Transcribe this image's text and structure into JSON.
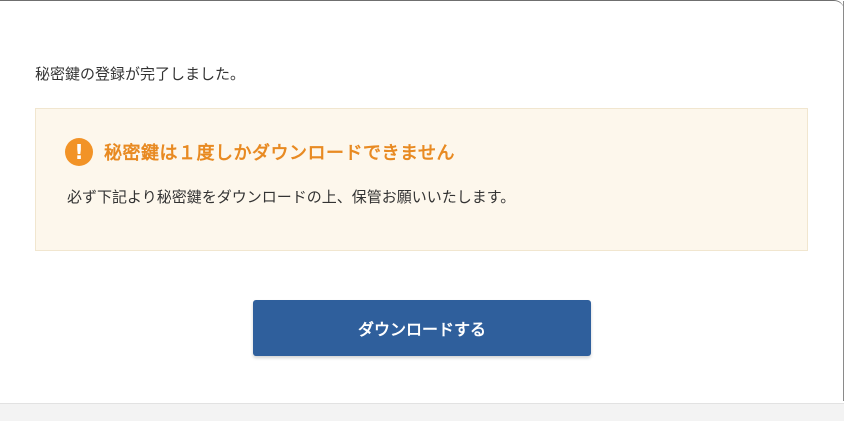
{
  "dialog": {
    "message": "秘密鍵の登録が完了しました。",
    "notice": {
      "icon": "exclamation-circle-icon",
      "icon_glyph": "!",
      "title": "秘密鍵は１度しかダウンロードできません",
      "body": "必ず下記より秘密鍵をダウンロードの上、保管お願いいたします。"
    },
    "download_button_label": "ダウンロードする"
  },
  "colors": {
    "notice_background": "#fdf7ec",
    "warning_accent": "#f29327",
    "warning_title": "#e88a22",
    "button_background": "#2f5f9c",
    "text": "#333333"
  }
}
